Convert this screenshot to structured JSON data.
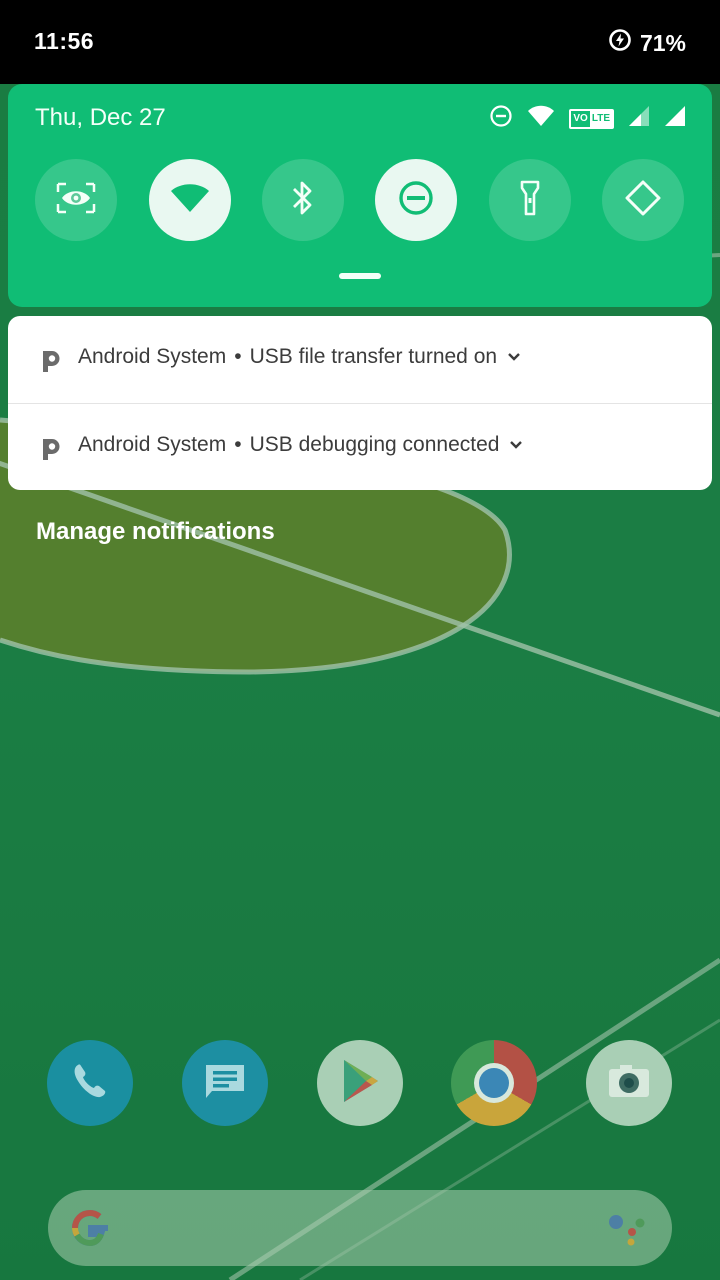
{
  "status_bar": {
    "time": "11:56",
    "battery_percent": "71%",
    "icons": [
      "data-saver-icon"
    ]
  },
  "quick_settings": {
    "date": "Thu, Dec 27",
    "status_icons": [
      "do-not-disturb-icon",
      "wifi-icon",
      "volte-icon",
      "signal-icon",
      "signal-icon"
    ],
    "volte_label_vo": "VO",
    "volte_label_lte": "LTE",
    "tiles": [
      {
        "name": "screen-cast-tile",
        "icon": "eye-icon",
        "state": "off"
      },
      {
        "name": "wifi-tile",
        "icon": "wifi-icon",
        "state": "on"
      },
      {
        "name": "bluetooth-tile",
        "icon": "bluetooth-icon",
        "state": "off"
      },
      {
        "name": "do-not-disturb-tile",
        "icon": "do-not-disturb-icon",
        "state": "on"
      },
      {
        "name": "flashlight-tile",
        "icon": "flashlight-icon",
        "state": "off"
      },
      {
        "name": "auto-rotate-tile",
        "icon": "rotate-icon",
        "state": "off"
      }
    ]
  },
  "notifications": [
    {
      "app": "Android System",
      "separator": "•",
      "title": "USB file transfer turned on"
    },
    {
      "app": "Android System",
      "separator": "•",
      "title": "USB debugging connected"
    }
  ],
  "manage_notifications": "Manage notifications",
  "dock": {
    "apps": [
      "phone-app",
      "messages-app",
      "play-store-app",
      "chrome-app",
      "camera-app"
    ]
  },
  "colors": {
    "panel": "#10bd75",
    "status_bar": "#000000",
    "wallpaper": "#1d8c4d"
  }
}
